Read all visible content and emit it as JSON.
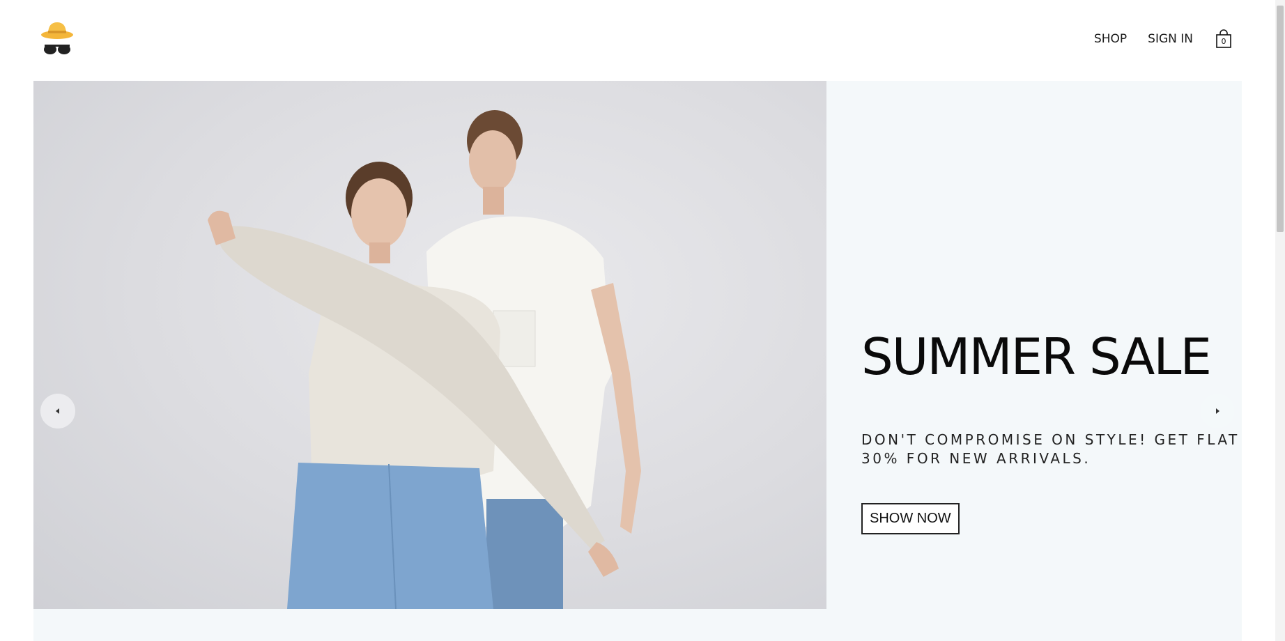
{
  "header": {
    "logo_icon": "hat-sunglasses-logo-icon",
    "nav": {
      "shop_label": "SHOP",
      "signin_label": "SIGN IN",
      "cart_icon": "shopping-bag-icon",
      "cart_count": "0"
    }
  },
  "hero": {
    "image_icon": "models-photo",
    "title": "SUMMER SALE",
    "subtitle": "DON'T COMPROMISE ON STYLE! GET FLAT 30% FOR NEW ARRIVALS.",
    "button_label": "SHOW NOW",
    "prev_icon": "caret-left-icon",
    "next_icon": "caret-right-icon"
  },
  "colors": {
    "hero_bg": "#f4f8fa",
    "text": "#0a0a0a"
  }
}
